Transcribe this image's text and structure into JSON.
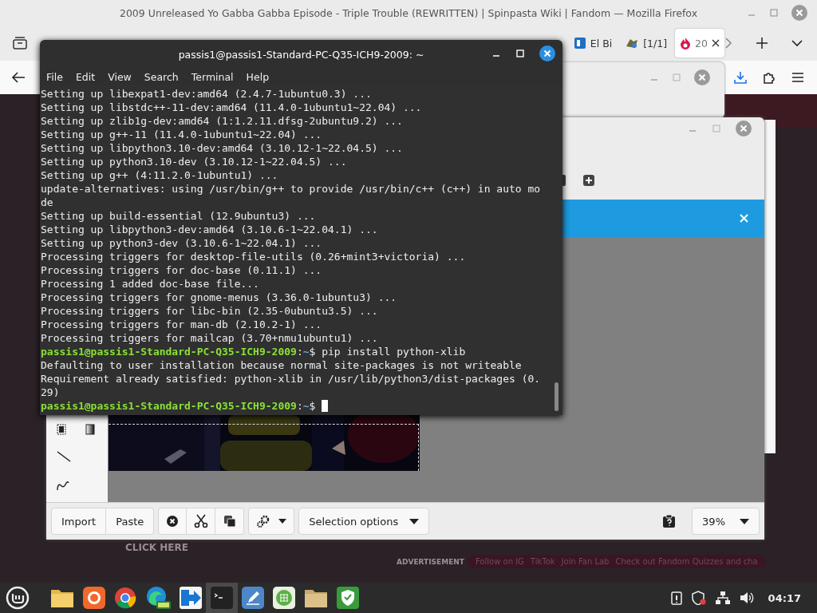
{
  "firefox": {
    "title": "2009 Unreleased Yo Gabba Gabba Episode - Triple Trouble (REWRITTEN) | Spinpasta Wiki | Fandom — Mozilla Firefox",
    "tabs": [
      {
        "label": "El Bi",
        "selected": false
      },
      {
        "label": "[1/1]",
        "selected": false
      },
      {
        "label": "20",
        "selected": true
      }
    ],
    "page": {
      "click_here": "CLICK HERE",
      "advertisement": "ADVERTISEMENT",
      "links": [
        "Follow on IG",
        "TikTok",
        "Join Fan Lab",
        "Check out Fandom Quizzes and cha"
      ]
    }
  },
  "drawing_app": {
    "toolbar": {
      "import": "Import",
      "paste": "Paste",
      "selection_options": "Selection options",
      "zoom": "39%"
    }
  },
  "terminal": {
    "title": "passis1@passis1-Standard-PC-Q35-ICH9-2009: ~",
    "menu": [
      "File",
      "Edit",
      "View",
      "Search",
      "Terminal",
      "Help"
    ],
    "lines": [
      {
        "kind": "output",
        "text": "Setting up libexpat1-dev:amd64 (2.4.7-1ubuntu0.3) ..."
      },
      {
        "kind": "output",
        "text": "Setting up libstdc++-11-dev:amd64 (11.4.0-1ubuntu1~22.04) ..."
      },
      {
        "kind": "output",
        "text": "Setting up zlib1g-dev:amd64 (1:1.2.11.dfsg-2ubuntu9.2) ..."
      },
      {
        "kind": "output",
        "text": "Setting up g++-11 (11.4.0-1ubuntu1~22.04) ..."
      },
      {
        "kind": "output",
        "text": "Setting up libpython3.10-dev:amd64 (3.10.12-1~22.04.5) ..."
      },
      {
        "kind": "output",
        "text": "Setting up python3.10-dev (3.10.12-1~22.04.5) ..."
      },
      {
        "kind": "output",
        "text": "Setting up g++ (4:11.2.0-1ubuntu1) ..."
      },
      {
        "kind": "output",
        "text": "update-alternatives: using /usr/bin/g++ to provide /usr/bin/c++ (c++) in auto mo"
      },
      {
        "kind": "output",
        "text": "de"
      },
      {
        "kind": "output",
        "text": "Setting up build-essential (12.9ubuntu3) ..."
      },
      {
        "kind": "output",
        "text": "Setting up libpython3-dev:amd64 (3.10.6-1~22.04.1) ..."
      },
      {
        "kind": "output",
        "text": "Setting up python3-dev (3.10.6-1~22.04.1) ..."
      },
      {
        "kind": "output",
        "text": "Processing triggers for desktop-file-utils (0.26+mint3+victoria) ..."
      },
      {
        "kind": "output",
        "text": "Processing triggers for doc-base (0.11.1) ..."
      },
      {
        "kind": "output",
        "text": "Processing 1 added doc-base file..."
      },
      {
        "kind": "output",
        "text": "Processing triggers for gnome-menus (3.36.0-1ubuntu3) ..."
      },
      {
        "kind": "output",
        "text": "Processing triggers for libc-bin (2.35-0ubuntu3.5) ..."
      },
      {
        "kind": "output",
        "text": "Processing triggers for man-db (2.10.2-1) ..."
      },
      {
        "kind": "output",
        "text": "Processing triggers for mailcap (3.70+nmu1ubuntu1) ..."
      },
      {
        "kind": "prompt",
        "user_host": "passis1@passis1-Standard-PC-Q35-ICH9-2009",
        "separator": ":",
        "path": "~",
        "symbol": "$",
        "command": "pip install python-xlib"
      },
      {
        "kind": "output",
        "text": "Defaulting to user installation because normal site-packages is not writeable"
      },
      {
        "kind": "output",
        "text": "Requirement already satisfied: python-xlib in /usr/lib/python3/dist-packages (0."
      },
      {
        "kind": "output",
        "text": "29)"
      },
      {
        "kind": "prompt",
        "user_host": "passis1@passis1-Standard-PC-Q35-ICH9-2009",
        "separator": ":",
        "path": "~",
        "symbol": "$",
        "cursor": true
      }
    ]
  },
  "taskbar": {
    "clock": "04:17"
  }
}
